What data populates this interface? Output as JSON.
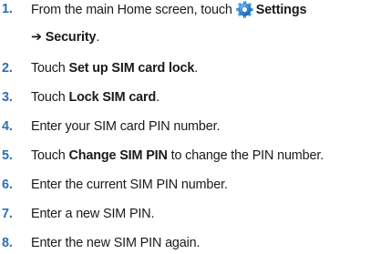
{
  "steps": [
    {
      "num": "1.",
      "pre": "From the main Home screen, touch",
      "b1": "Settings",
      "arrow": "➔",
      "b2": "Security",
      "post": ".",
      "icon": "settings-gear-icon"
    },
    {
      "num": "2.",
      "pre": "Touch ",
      "b": "Set up SIM card lock",
      "post": "."
    },
    {
      "num": "3.",
      "pre": "Touch ",
      "b": "Lock SIM card",
      "post": "."
    },
    {
      "num": "4.",
      "text": "Enter your SIM card PIN number."
    },
    {
      "num": "5.",
      "pre": "Touch ",
      "b": "Change SIM PIN",
      "post": " to change the PIN number."
    },
    {
      "num": "6.",
      "text": "Enter the current SIM PIN number."
    },
    {
      "num": "7.",
      "text": "Enter a new SIM PIN."
    },
    {
      "num": "8.",
      "text": "Enter the new SIM PIN again."
    }
  ],
  "colors": {
    "step_number": "#2f6fb4",
    "body_text": "#1a1a1a",
    "icon_blue": "#2a86d6"
  }
}
